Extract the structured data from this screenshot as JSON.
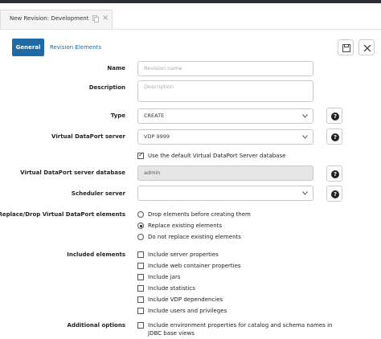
{
  "tab": {
    "title": "New Revision: Development",
    "close": "×"
  },
  "tabs": {
    "general": "General",
    "elements": "Revision Elements"
  },
  "form": {
    "name": {
      "label": "Name",
      "placeholder": "Revision name"
    },
    "description": {
      "label": "Description",
      "placeholder": "Description"
    },
    "type": {
      "label": "Type",
      "value": "CREATE"
    },
    "vdp_server": {
      "label": "Virtual DataPort server",
      "value": "VDP 9999"
    },
    "use_default_db": {
      "label": "Use the default Virtual DataPort Server database",
      "checked": true
    },
    "vdp_database": {
      "label": "Virtual DataPort server database",
      "value": "admin"
    },
    "scheduler": {
      "label": "Scheduler server",
      "value": ""
    },
    "replace": {
      "label": "Replace/Drop Virtual DataPort elements",
      "options": [
        "Drop elements before creating them",
        "Replace existing elements",
        "Do not replace existing elements"
      ],
      "selected": 1
    },
    "included": {
      "label": "Included elements",
      "options": [
        "Include server properties",
        "Include web container properties",
        "Include jars",
        "Include statistics",
        "Include VDP dependencies",
        "Include users and privileges"
      ]
    },
    "additional": {
      "label": "Additional options",
      "option_line1": "Include environment properties for catalog and schema names in",
      "option_line2": "JDBC base views"
    }
  },
  "help_glyph": "?"
}
